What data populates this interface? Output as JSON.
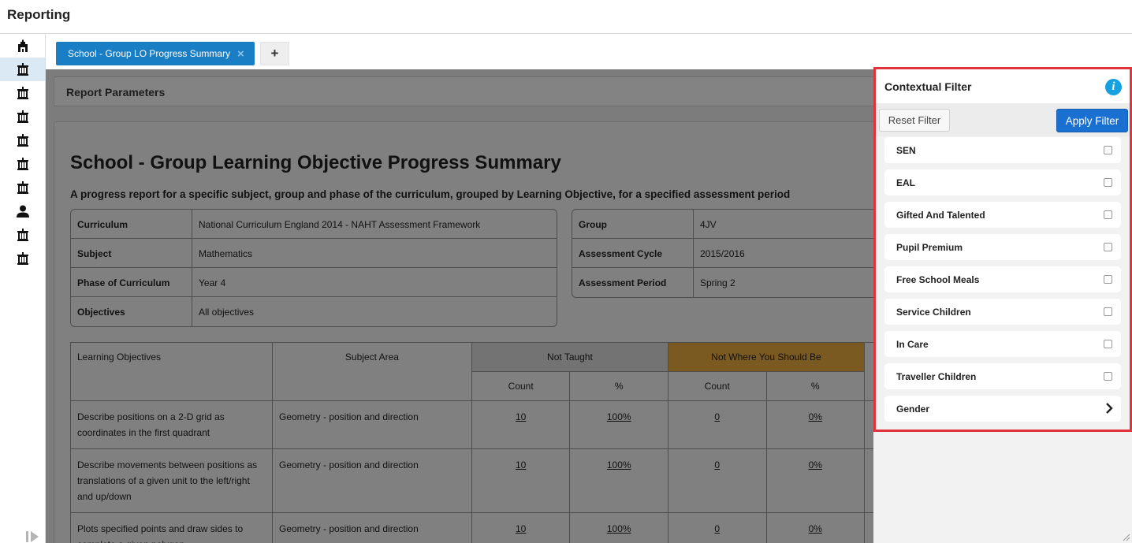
{
  "app": {
    "title": "Reporting"
  },
  "tabs": [
    {
      "label": "School - Group LO Progress Summary"
    }
  ],
  "add_tab_label": "+",
  "params": {
    "title": "Report Parameters"
  },
  "report": {
    "title": "School - Group Learning Objective Progress Summary",
    "subtitle": "A progress report for a specific subject, group and phase of the curriculum, grouped by Learning Objective, for a specified assessment period",
    "left_info": [
      {
        "k": "Curriculum",
        "v": "National Curriculum England 2014 - NAHT Assessment Framework"
      },
      {
        "k": "Subject",
        "v": "Mathematics"
      },
      {
        "k": "Phase of Curriculum",
        "v": "Year 4"
      },
      {
        "k": "Objectives",
        "v": "All objectives"
      }
    ],
    "right_info": [
      {
        "k": "Group",
        "v": "4JV"
      },
      {
        "k": "Assessment Cycle",
        "v": "2015/2016"
      },
      {
        "k": "Assessment Period",
        "v": "Spring 2"
      }
    ],
    "table": {
      "h_lo": "Learning Objectives",
      "h_area": "Subject Area",
      "h_not_taught": "Not Taught",
      "h_not_where": "Not Where You Should Be",
      "h_count": "Count",
      "h_pct": "%",
      "rows": [
        {
          "lo": "Describe positions on a 2-D grid as coordinates in the first quadrant",
          "area": "Geometry - position and direction",
          "nt_count": "10",
          "nt_pct": "100%",
          "nw_count": "0",
          "nw_pct": "0%"
        },
        {
          "lo": "Describe movements between positions as translations of a given unit to the left/right and up/down",
          "area": "Geometry - position and direction",
          "nt_count": "10",
          "nt_pct": "100%",
          "nw_count": "0",
          "nw_pct": "0%"
        },
        {
          "lo": "Plots specified points and draw sides to complete a given polygon",
          "area": "Geometry - position and direction",
          "nt_count": "10",
          "nt_pct": "100%",
          "nw_count": "0",
          "nw_pct": "0%"
        }
      ]
    }
  },
  "filter": {
    "title": "Contextual Filter",
    "info_glyph": "i",
    "reset_label": "Reset Filter",
    "apply_label": "Apply Filter",
    "items": [
      {
        "label": "SEN"
      },
      {
        "label": "EAL"
      },
      {
        "label": "Gifted And Talented"
      },
      {
        "label": "Pupil Premium"
      },
      {
        "label": "Free School Meals"
      },
      {
        "label": "Service Children"
      },
      {
        "label": "In Care"
      },
      {
        "label": "Traveller Children"
      },
      {
        "label": "Gender"
      }
    ]
  },
  "colors": {
    "tab_blue": "#1a7ec4",
    "apply_blue": "#1a70d0",
    "highlight_red": "#e0333b",
    "info_blue": "#17a0e0",
    "not_taught_bg": "#737373",
    "not_where_bg": "#7b5a22"
  },
  "icons": [
    "school-group-icon",
    "school-building-icon",
    "person-icon",
    "sidebar-collapse-icon",
    "close-icon",
    "info-icon",
    "chevron-right-icon"
  ]
}
